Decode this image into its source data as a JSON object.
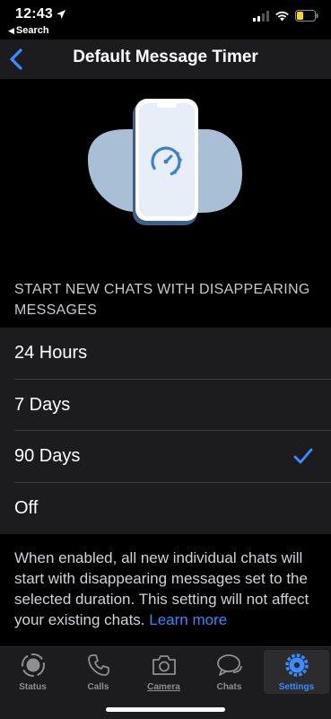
{
  "status_bar": {
    "time": "12:43",
    "back_label": "Search"
  },
  "nav": {
    "title": "Default Message Timer"
  },
  "section_header": "START NEW CHATS WITH DISAPPEARING MESSAGES",
  "options": [
    {
      "label": "24 Hours",
      "selected": false
    },
    {
      "label": "7 Days",
      "selected": false
    },
    {
      "label": "90 Days",
      "selected": true
    },
    {
      "label": "Off",
      "selected": false
    }
  ],
  "footer": {
    "text": "When enabled, all new individual chats will start with disappearing messages set to the selected duration. This setting will not affect your existing chats.",
    "link": "Learn more"
  },
  "tabs": [
    {
      "label": "Status",
      "icon": "status-icon",
      "active": false
    },
    {
      "label": "Calls",
      "icon": "phone-icon",
      "active": false
    },
    {
      "label": "Camera",
      "icon": "camera-icon",
      "active": false
    },
    {
      "label": "Chats",
      "icon": "chat-bubbles-icon",
      "active": false
    },
    {
      "label": "Settings",
      "icon": "gear-icon",
      "active": true
    }
  ],
  "colors": {
    "accent": "#3b8cff",
    "background": "#000000",
    "cell": "#1c1c1e",
    "separator": "#3a3a3c",
    "illustration_blob": "#a9bfd6",
    "illustration_timer": "#3b7dd8"
  }
}
